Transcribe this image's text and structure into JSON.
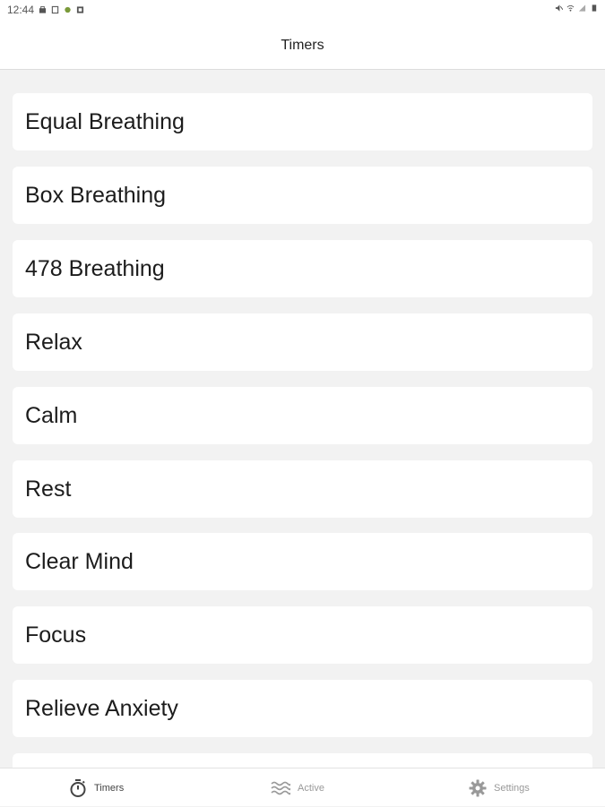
{
  "status_bar": {
    "time": "12:44"
  },
  "header": {
    "title": "Timers"
  },
  "timers": [
    {
      "label": "Equal Breathing"
    },
    {
      "label": "Box Breathing"
    },
    {
      "label": "478 Breathing"
    },
    {
      "label": "Relax"
    },
    {
      "label": "Calm"
    },
    {
      "label": "Rest"
    },
    {
      "label": "Clear Mind"
    },
    {
      "label": "Focus"
    },
    {
      "label": "Relieve Anxiety"
    },
    {
      "label": ""
    }
  ],
  "bottom_nav": {
    "items": [
      {
        "label": "Timers",
        "icon": "stopwatch-icon",
        "active": true
      },
      {
        "label": "Active",
        "icon": "waves-icon",
        "active": false
      },
      {
        "label": "Settings",
        "icon": "gear-icon",
        "active": false
      }
    ]
  },
  "colors": {
    "background": "#f2f2f2",
    "card": "#ffffff",
    "header": "#ffffff"
  }
}
